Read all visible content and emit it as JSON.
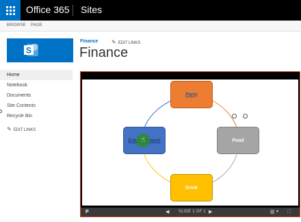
{
  "suite": {
    "brand": "Office 365",
    "app": "Sites"
  },
  "ribbon": {
    "tabs": [
      "BROWSE",
      "PAGE"
    ]
  },
  "header": {
    "breadcrumb": "Finance",
    "edit_links": "EDIT LINKS",
    "title": "Finance"
  },
  "nav": {
    "items": [
      "Home",
      "Notebook",
      "Documents",
      "Site Contents",
      "Recycle Bin"
    ],
    "edit_links": "EDIT LINKS"
  },
  "slide": {
    "nodes": {
      "party": "Party",
      "food": "Food",
      "drink": "Drink",
      "entertainment": "Entertainment"
    },
    "counter": "SLIDE 1 OF 1"
  },
  "colors": {
    "accent": "#0072c6",
    "viewer_border": "#d24726",
    "party": "#ed7d31",
    "food": "#a5a5a5",
    "drink": "#ffc000",
    "entertainment": "#4472c4"
  },
  "icons": {
    "waffle": "app-launcher-icon",
    "pencil": "pencil-icon",
    "prev": "triangle-left",
    "next": "triangle-right",
    "layout": "panel-layout-icon",
    "fullscreen": "expand-icon",
    "app": "powerpoint-icon"
  }
}
